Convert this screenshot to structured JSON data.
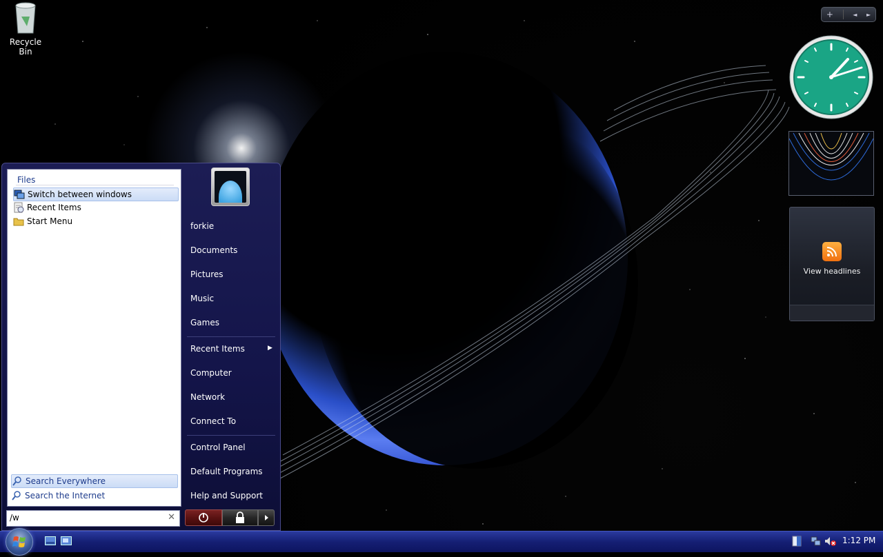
{
  "desktop": {
    "recycle_bin_label": "Recycle Bin"
  },
  "sidebar": {
    "add_label": "+",
    "prev_label": "◄",
    "next_label": "►",
    "feeds_label": "View headlines"
  },
  "start_menu": {
    "group_heading": "Files",
    "results": [
      {
        "label": "Switch between windows",
        "icon": "switch-windows-icon",
        "selected": true
      },
      {
        "label": "Recent Items",
        "icon": "recent-items-icon",
        "selected": false
      },
      {
        "label": "Start Menu",
        "icon": "folder-icon",
        "selected": false
      }
    ],
    "search_actions": [
      {
        "label": "Search Everywhere",
        "icon": "search-icon",
        "selected": true
      },
      {
        "label": "Search the Internet",
        "icon": "search-icon",
        "selected": false
      }
    ],
    "search_value": "/w",
    "right_items": {
      "user": "forkie",
      "documents": "Documents",
      "pictures": "Pictures",
      "music": "Music",
      "games": "Games",
      "recent": "Recent Items",
      "computer": "Computer",
      "network": "Network",
      "connect": "Connect To",
      "control_panel": "Control Panel",
      "default_programs": "Default Programs",
      "help": "Help and Support"
    }
  },
  "taskbar": {
    "clock": "1:12 PM"
  },
  "colors": {
    "accent": "#1e3c8c",
    "menu_bg": "#1c1d54",
    "taskbar": "#151f74"
  }
}
